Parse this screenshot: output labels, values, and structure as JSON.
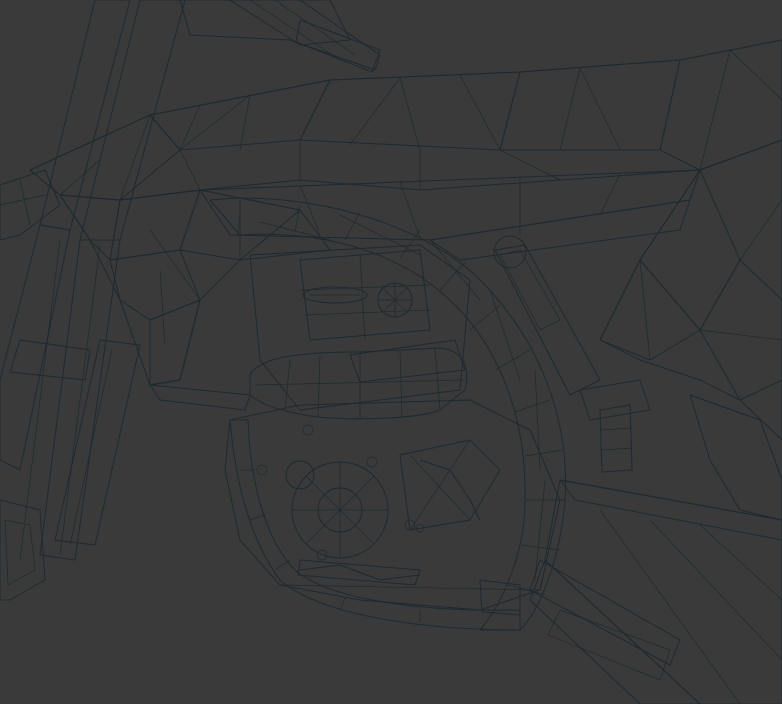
{
  "scene": {
    "subject": "motocross-bike-wireframe",
    "colors": {
      "background": "#3a3a3a",
      "mesh_light": "#a9bcc6",
      "mesh_mid": "#8aa0ac",
      "mesh_dark": "#5f7480",
      "mesh_shadow": "#44545e",
      "mesh_blue": "#8f9fc2",
      "wire": "#1e2a30"
    }
  }
}
